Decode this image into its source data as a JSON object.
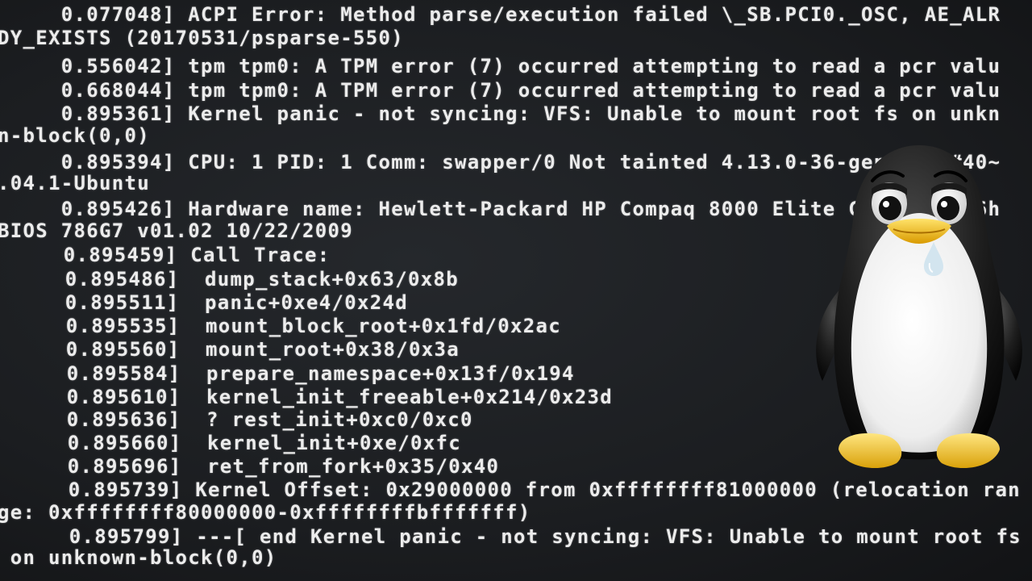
{
  "console": {
    "lines": [
      {
        "id": "l01",
        "text": "     0.077048] ACPI Error: Method parse/execution failed \\_SB.PCI0._OSC, AE_ALR"
      },
      {
        "id": "l02",
        "text": "DY_EXISTS (20170531/psparse-550)"
      },
      {
        "id": "l03",
        "text": "     0.556042] tpm tpm0: A TPM error (7) occurred attempting to read a pcr valu"
      },
      {
        "id": "l04",
        "text": "     0.668044] tpm tpm0: A TPM error (7) occurred attempting to read a pcr valu"
      },
      {
        "id": "l05",
        "text": "     0.895361] Kernel panic - not syncing: VFS: Unable to mount root fs on unkn"
      },
      {
        "id": "l06",
        "text": "n-block(0,0)"
      },
      {
        "id": "l07",
        "text": "     0.895394] CPU: 1 PID: 1 Comm: swapper/0 Not tainted 4.13.0-36-generic #40~"
      },
      {
        "id": "l08",
        "text": ".04.1-Ubuntu"
      },
      {
        "id": "l09",
        "text": "     0.895426] Hardware name: Hewlett-Packard HP Compaq 8000 Elite CMT PC/3646h"
      },
      {
        "id": "l10",
        "text": "BIOS 786G7 v01.02 10/22/2009"
      },
      {
        "id": "l11",
        "text": "     0.895459] Call Trace:"
      },
      {
        "id": "l12",
        "text": "     0.895486]  dump_stack+0x63/0x8b"
      },
      {
        "id": "l13",
        "text": "     0.895511]  panic+0xe4/0x24d"
      },
      {
        "id": "l14",
        "text": "     0.895535]  mount_block_root+0x1fd/0x2ac"
      },
      {
        "id": "l15",
        "text": "     0.895560]  mount_root+0x38/0x3a"
      },
      {
        "id": "l16",
        "text": "     0.895584]  prepare_namespace+0x13f/0x194"
      },
      {
        "id": "l17",
        "text": "     0.895610]  kernel_init_freeable+0x214/0x23d"
      },
      {
        "id": "l18",
        "text": "     0.895636]  ? rest_init+0xc0/0xc0"
      },
      {
        "id": "l19",
        "text": "     0.895660]  kernel_init+0xe/0xfc"
      },
      {
        "id": "l20",
        "text": "     0.895696]  ret_from_fork+0x35/0x40"
      },
      {
        "id": "l21",
        "text": "     0.895739] Kernel Offset: 0x29000000 from 0xffffffff81000000 (relocation ran"
      },
      {
        "id": "l22",
        "text": "ge: 0xffffffff80000000-0xffffffffbfffffff)"
      },
      {
        "id": "l23",
        "text": "     0.895799] ---[ end Kernel panic - not syncing: VFS: Unable to mount root fs"
      },
      {
        "id": "l24",
        "text": " on unknown-block(0,0)"
      }
    ]
  },
  "colors": {
    "background": "#1b1d20",
    "text": "#ececec",
    "tux_body": "#1a1a1a",
    "tux_belly": "#f4f4f4",
    "tux_beak": "#f2c20e",
    "tear": "#cfe3ee"
  },
  "overlay": {
    "icon": "sad-tux-penguin-icon"
  }
}
